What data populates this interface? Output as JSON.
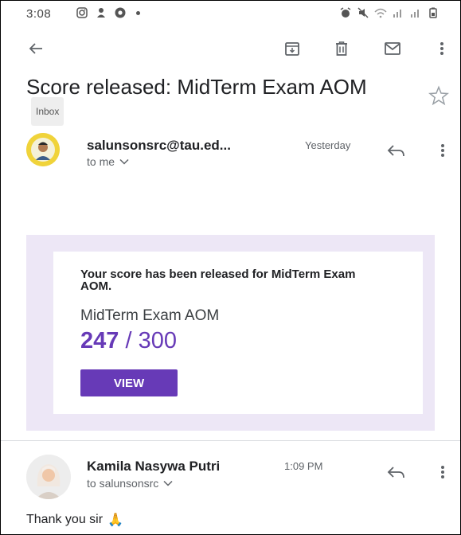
{
  "status_bar": {
    "time": "3:08",
    "left_icons": [
      "instagram-icon",
      "person-icon",
      "chrome-icon",
      "dot-icon"
    ],
    "right_icons": [
      "alarm-icon",
      "mute-icon",
      "wifi-icon",
      "signal-icon",
      "signal-icon",
      "battery-icon"
    ]
  },
  "toolbar": {
    "icons": [
      "back-arrow-icon",
      "archive-icon",
      "delete-icon",
      "mark-unread-icon",
      "more-vert-icon"
    ]
  },
  "subject": {
    "text": "Score released: MidTerm Exam AOM",
    "label": "Inbox"
  },
  "message1": {
    "sender": "salunsonsrc@tau.ed...",
    "time": "Yesterday",
    "to": "to me"
  },
  "email_card": {
    "heading": "Your score has been released for MidTerm Exam AOM.",
    "exam_name": "MidTerm Exam AOM",
    "score_obtained": "247",
    "score_separator": "/",
    "score_total": "300",
    "button": "VIEW",
    "accent_color": "#673ab7",
    "card_bg_color": "#ede7f6"
  },
  "message2": {
    "sender": "Kamila Nasywa Putri",
    "time": "1:09 PM",
    "to": "to salunsonsrc",
    "body": "Thank you sir",
    "emoji": "🙏"
  }
}
